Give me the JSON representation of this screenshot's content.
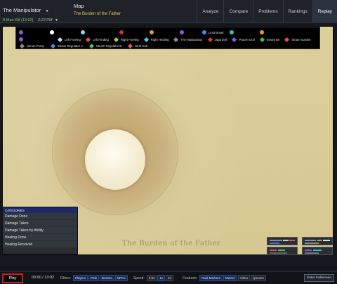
{
  "header": {
    "boss_name": "The Manipulator",
    "kill_text": "8-Man Kill (13:02)",
    "kill_time": "2:22 PM",
    "map_title": "Map",
    "map_subtitle": "The Burden of the Father",
    "tabs": [
      "Analyze",
      "Compare",
      "Problems",
      "Rankings",
      "Replay"
    ]
  },
  "legend": {
    "row1": [
      {
        "label": "",
        "color": "#8a5bd0",
        "shape": "dot"
      },
      {
        "label": "",
        "color": "#ffffff",
        "shape": "dot"
      },
      {
        "label": "",
        "color": "#8ad9ea",
        "shape": "dot"
      },
      {
        "label": "",
        "color": "#c33",
        "shape": "dot"
      },
      {
        "label": "",
        "color": "#e39a35",
        "shape": "dot"
      },
      {
        "label": "",
        "color": "#8a5bd0",
        "shape": "dot"
      },
      {
        "label": "Limit Break",
        "color": "#3a8ef0",
        "shape": "dot"
      },
      {
        "label": "",
        "color": "#2fc2c2",
        "shape": "dot"
      },
      {
        "label": "",
        "color": "#e39a35",
        "shape": "dot"
      }
    ],
    "row2": [
      {
        "label": "",
        "color": "#8a5bd0",
        "shape": "dot"
      },
      {
        "label": "Left Foreleg",
        "color": "#b8e3f3",
        "shape": "dia"
      },
      {
        "label": "Left Hindleg",
        "color": "#e05050",
        "shape": "dia"
      },
      {
        "label": "Right Foreleg",
        "color": "#8bd35a",
        "shape": "dia"
      },
      {
        "label": "Right Hindleg",
        "color": "#56c7e0",
        "shape": "dia"
      },
      {
        "label": "The Manipulator",
        "color": "#8a8a8a",
        "shape": "dia"
      },
      {
        "label": "Jagd Doll",
        "color": "#e03a3a",
        "shape": "dia"
      },
      {
        "label": "Panzer Doll",
        "color": "#8a5bd0",
        "shape": "dia"
      },
      {
        "label": "Steam Bit",
        "color": "#4bbf5a",
        "shape": "dia"
      },
      {
        "label": "Steam Gasket",
        "color": "#e05050",
        "shape": "dia"
      }
    ],
    "row3": [
      {
        "label": "Steam Pump",
        "color": "#8a8a8a",
        "shape": "dia"
      },
      {
        "label": "Steam Regulator A",
        "color": "#3a8ef0",
        "shape": "dia"
      },
      {
        "label": "Steam Regulator B",
        "color": "#4bbf5a",
        "shape": "dia"
      },
      {
        "label": "Straf Doll",
        "color": "#e05050",
        "shape": "dia"
      }
    ]
  },
  "map": {
    "watermark": "The Burden of the Father"
  },
  "categories": {
    "header": "Categories",
    "items": [
      "Damage Done",
      "Damage Taken",
      "Damage Taken by Ability",
      "Healing Done",
      "Healing Received"
    ]
  },
  "bottom": {
    "play": "Play",
    "time": "00:00 / 13:02",
    "filters_label": "Filters:",
    "filters": [
      "Players",
      "Pets",
      "Bosses",
      "NPCs"
    ],
    "speed_label": "Speed:",
    "speeds": [
      "0.5x",
      "1x",
      "2x"
    ],
    "features_label": "Features:",
    "features": [
      "Raid Markers",
      "Meters",
      "Video",
      "Queues"
    ],
    "fullscreen": "Enter Fullscreen"
  }
}
